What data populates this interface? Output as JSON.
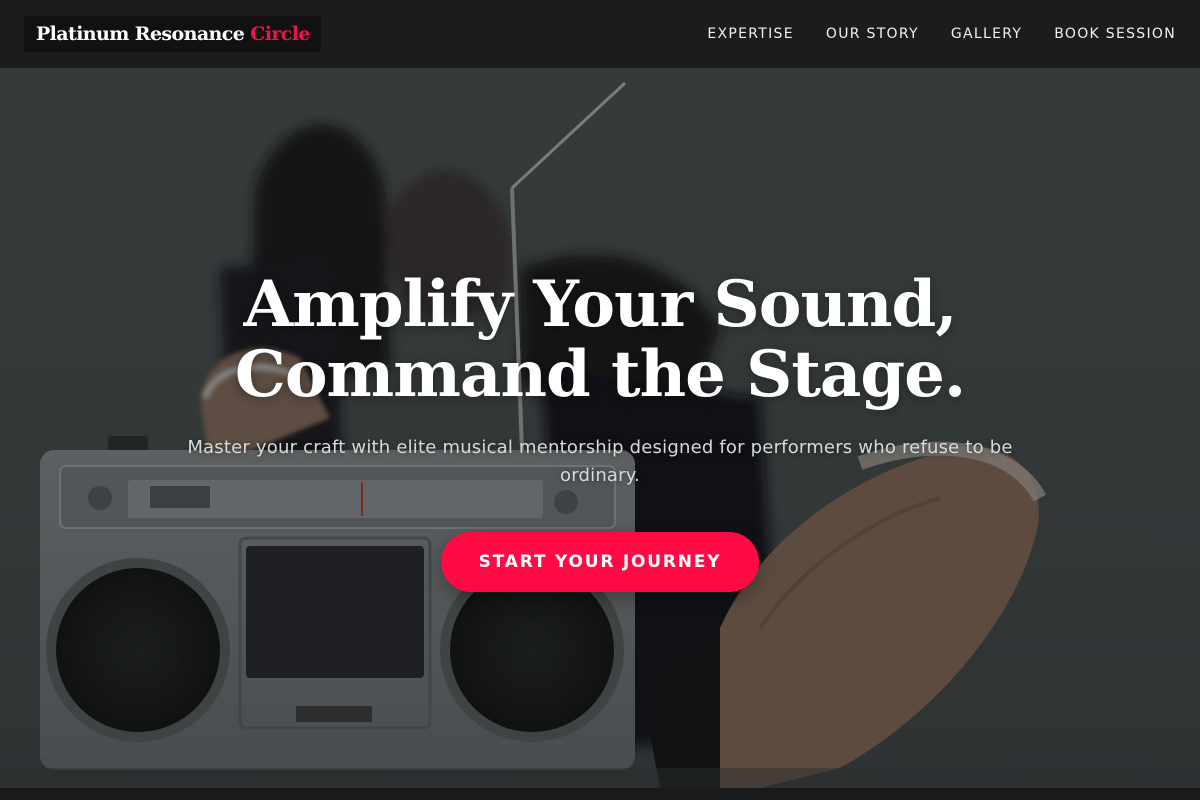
{
  "brand": {
    "name": "Platinum Resonance",
    "accent": "Circle",
    "accent_color": "#e8174a"
  },
  "nav": {
    "links": [
      {
        "label": "EXPERTISE"
      },
      {
        "label": "OUR STORY"
      },
      {
        "label": "GALLERY"
      },
      {
        "label": "BOOK SESSION"
      }
    ]
  },
  "hero": {
    "headline_line1": "Amplify Your Sound,",
    "headline_line2": "Command the Stage.",
    "subtitle": "Master your craft with elite musical mentorship designed for performers who refuse to be ordinary.",
    "cta_label": "START YOUR JOURNEY",
    "cta_color": "#ff0a45",
    "image_icon": "boombox-photo"
  },
  "colors": {
    "nav_bg": "#1c1c1c",
    "text": "#ffffff"
  }
}
